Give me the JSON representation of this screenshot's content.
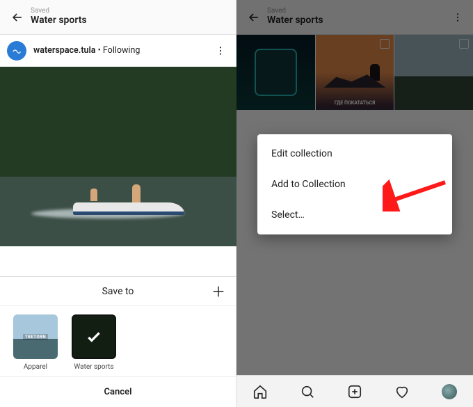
{
  "left": {
    "header": {
      "saved_label": "Saved",
      "title": "Water sports"
    },
    "user": {
      "name": "waterspace.tula",
      "follow_text": " • Following"
    },
    "sheet": {
      "title": "Save to",
      "collections": [
        {
          "name": "Apparel",
          "thumb_label": "TRETORN"
        },
        {
          "name": "Water sports"
        }
      ],
      "cancel_label": "Cancel"
    }
  },
  "right": {
    "header": {
      "saved_label": "Saved",
      "title": "Water sports"
    },
    "menu": {
      "items": [
        {
          "label": "Edit collection"
        },
        {
          "label": "Add to Collection"
        },
        {
          "label": "Select…"
        }
      ]
    },
    "grid_overlay_text": "ГДЕ ПОКАТАТЬСЯ"
  }
}
